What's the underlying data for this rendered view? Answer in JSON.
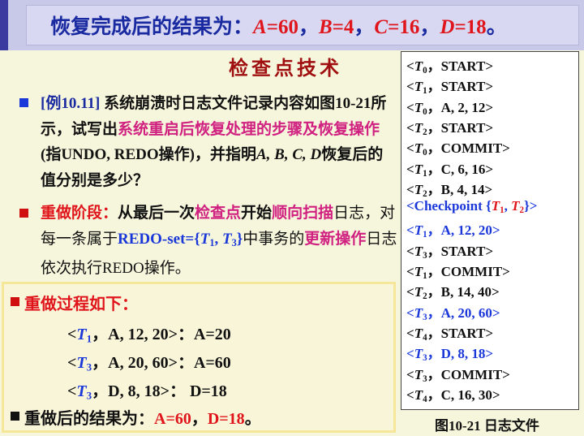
{
  "banner": {
    "prefix": "恢复完成后的结果为：",
    "a_var": "A",
    "a_val": "=60",
    "sep1": "，",
    "b_var": "B",
    "b_val": "=4",
    "sep2": "，",
    "c_var": "C",
    "c_val": "=16",
    "sep3": "，",
    "d_var": "D",
    "d_val": "=18",
    "end": "。"
  },
  "heading": "检查点技术",
  "example": {
    "tag": "[例10.11]",
    "t1": " 系统崩溃时日志文件记录内容如图10-21所示，试写出",
    "hl1": "系统重启后恢复处理的步骤及恢复操作",
    "t2": "(指UNDO, REDO操作)，并指明",
    "vars": "A, B, C, D",
    "t3": "恢复后的值分别是多少？"
  },
  "redo_stage": {
    "label": "重做阶段：",
    "t1": "从最后一次",
    "hl1": "检查点",
    "t2": "开始",
    "hl2": "顺向扫描",
    "t3": "日志，对每一条属于",
    "redo_set": "REDO-set={",
    "t1v": "T",
    "t1s": "1",
    "comma": ", ",
    "t3v": "T",
    "t3s": "3",
    "close": "}",
    "t4": "中事务的",
    "hl3": "更新操作",
    "t5": "日志依次执行REDO操作。"
  },
  "redo_process": {
    "title": "重做过程如下：",
    "steps": [
      {
        "open": "<",
        "t": "T",
        "sub": "1",
        "rest": "，A, 12, 20>",
        "colon": "：",
        "result": "A=20"
      },
      {
        "open": "<",
        "t": "T",
        "sub": "3",
        "rest": "，A, 20, 60>",
        "colon": "：",
        "result": "A=60"
      },
      {
        "open": "<",
        "t": "T",
        "sub": "3",
        "rest": "，D, 8, 18>",
        "colon": "：  ",
        "result": "D=18"
      }
    ],
    "final_label": "重做后的结果为：",
    "final_a": "A=60",
    "final_sep": "，",
    "final_d": "D=18",
    "final_end": "。"
  },
  "log": {
    "entries": [
      {
        "txn": "0",
        "body": "，START>",
        "color": "black"
      },
      {
        "txn": "1",
        "body": "，START>",
        "color": "black"
      },
      {
        "txn": "0",
        "body": "，A, 2, 12>",
        "color": "black"
      },
      {
        "txn": "2",
        "body": "，START>",
        "color": "black"
      },
      {
        "txn": "0",
        "body": "，COMMIT>",
        "color": "black"
      },
      {
        "txn": "1",
        "body": "，C, 6, 16>",
        "color": "black"
      },
      {
        "txn": "2",
        "body": "，B, 4, 14>",
        "color": "black"
      },
      {
        "checkpoint": true,
        "text": "<Checkpoint {",
        "t1": "1",
        "t2": "2",
        "end": "}>"
      },
      {
        "txn": "1",
        "body": "，A, 12, 20>",
        "color": "blue"
      },
      {
        "txn": "3",
        "body": "，START>",
        "color": "black"
      },
      {
        "txn": "1",
        "body": "，COMMIT>",
        "color": "black"
      },
      {
        "txn": "2",
        "body": "，B, 14, 40>",
        "color": "black"
      },
      {
        "txn": "3",
        "body": "，A, 20, 60>",
        "color": "blue"
      },
      {
        "txn": "4",
        "body": "，START>",
        "color": "black"
      },
      {
        "txn": "3",
        "body": "，D, 8, 18>",
        "color": "blue"
      },
      {
        "txn": "3",
        "body": "，COMMIT>",
        "color": "black"
      },
      {
        "txn": "4",
        "body": "，C, 16, 30>",
        "color": "black"
      }
    ],
    "caption": "图10-21  日志文件"
  }
}
